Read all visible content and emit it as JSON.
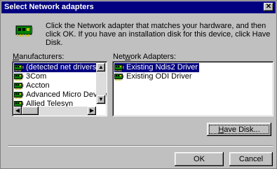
{
  "dialog": {
    "title": "Select Network adapters",
    "close_glyph": "✕",
    "intro_text": "Click the Network adapter that matches your hardware, and then click OK. If you have an installation disk for this device, click Have Disk."
  },
  "manufacturers": {
    "label_prefix": "",
    "label_underline": "M",
    "label_rest": "anufacturers:",
    "items": [
      {
        "label": "(detected net drivers)",
        "selected": true
      },
      {
        "label": "3Com",
        "selected": false
      },
      {
        "label": "Accton",
        "selected": false
      },
      {
        "label": "Advanced Micro Device",
        "selected": false
      },
      {
        "label": "Allied Telesyn",
        "selected": false
      }
    ]
  },
  "adapters": {
    "label_prefix": "Net",
    "label_underline": "w",
    "label_rest": "ork Adapters:",
    "items": [
      {
        "label": "Existing Ndis2 Driver",
        "selected": true
      },
      {
        "label": "Existing ODI Driver",
        "selected": false
      }
    ]
  },
  "buttons": {
    "have_disk_underline": "H",
    "have_disk_rest": "ave Disk...",
    "ok": "OK",
    "cancel": "Cancel"
  },
  "icons": {
    "header": "network-card-icon",
    "list_item": "network-card-icon"
  },
  "colors": {
    "face": "#c0c0c0",
    "titlebar": "#000080",
    "selection": "#000080"
  }
}
